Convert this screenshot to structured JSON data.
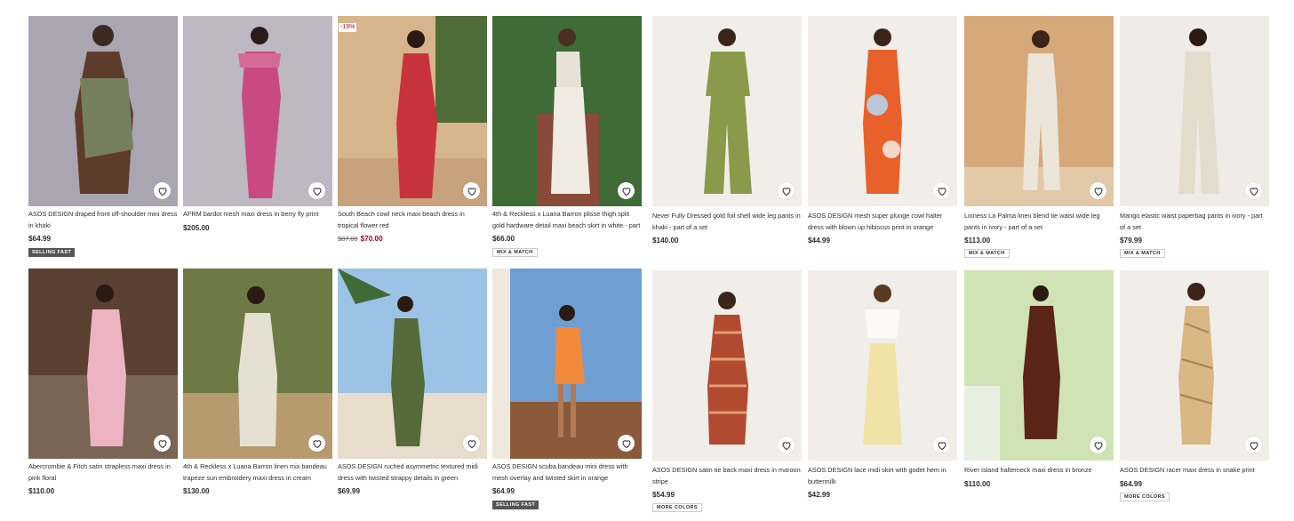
{
  "heart_icon": "heart-outline-icon",
  "colors": {
    "sale": "#b4002e",
    "selling_fast_bg": "#555555"
  },
  "products": [
    {
      "title": "ASOS DESIGN draped front off-shoulder mini dress in khaki",
      "price": "$64.99",
      "badge": "SELLING FAST",
      "badge_style": "dark"
    },
    {
      "title": "AFRM bardot mesh maxi dress in berry fly print",
      "price": "$205.00"
    },
    {
      "title": "South Beach cowl neck maxi beach dress in tropical flower red",
      "old_price": "$87.00",
      "sale_price": "$70.00",
      "discount": "-19%"
    },
    {
      "title": "4th & Reckless x Luana Barron plisse thigh split gold hardware detail maxi beach skirt in white - part of ...",
      "price": "$66.00",
      "badge": "MIX & MATCH",
      "badge_style": "light"
    },
    {
      "title": "Never Fully Dressed gold foil shell wide leg pants in khaki - part of a set",
      "price": "$140.00"
    },
    {
      "title": "ASOS DESIGN mesh super plunge cowl halter dress with blown up hibiscus print in orange",
      "price": "$44.99"
    },
    {
      "title": "Lioness La Palma linen blend tie waist wide leg pants in ivory - part of a set",
      "price": "$113.00",
      "badge": "MIX & MATCH",
      "badge_style": "light"
    },
    {
      "title": "Mango elastic waist paperbag pants in ivory - part of a set",
      "price": "$79.99",
      "badge": "MIX & MATCH",
      "badge_style": "light"
    },
    {
      "title": "Abercrombie & Fitch satin strapless maxi dress in pink floral",
      "price": "$110.00"
    },
    {
      "title": "4th & Reckless x Luana Barron linen mix bandeau trapeze sun embroidery maxi dress in cream",
      "price": "$130.00"
    },
    {
      "title": "ASOS DESIGN ruched asymmetric textured midi dress with twisted strappy details in green",
      "price": "$69.99"
    },
    {
      "title": "ASOS DESIGN scuba bandeau mini dress with mesh overlay and twisted skirt in orange",
      "price": "$64.99",
      "badge": "SELLING FAST",
      "badge_style": "dark"
    },
    {
      "title": "ASOS DESIGN satin tie back maxi dress in maroon stripe",
      "price": "$54.99",
      "badge": "MORE COLORS",
      "badge_style": "light"
    },
    {
      "title": "ASOS DESIGN lace midi skirt with godet hem in buttermilk",
      "price": "$42.99"
    },
    {
      "title": "River Island halterneck maxi dress in bronze",
      "price": "$110.00"
    },
    {
      "title": "ASOS DESIGN racer maxi dress in snake print",
      "price": "$64.99",
      "badge": "MORE COLORS",
      "badge_style": "light"
    }
  ]
}
